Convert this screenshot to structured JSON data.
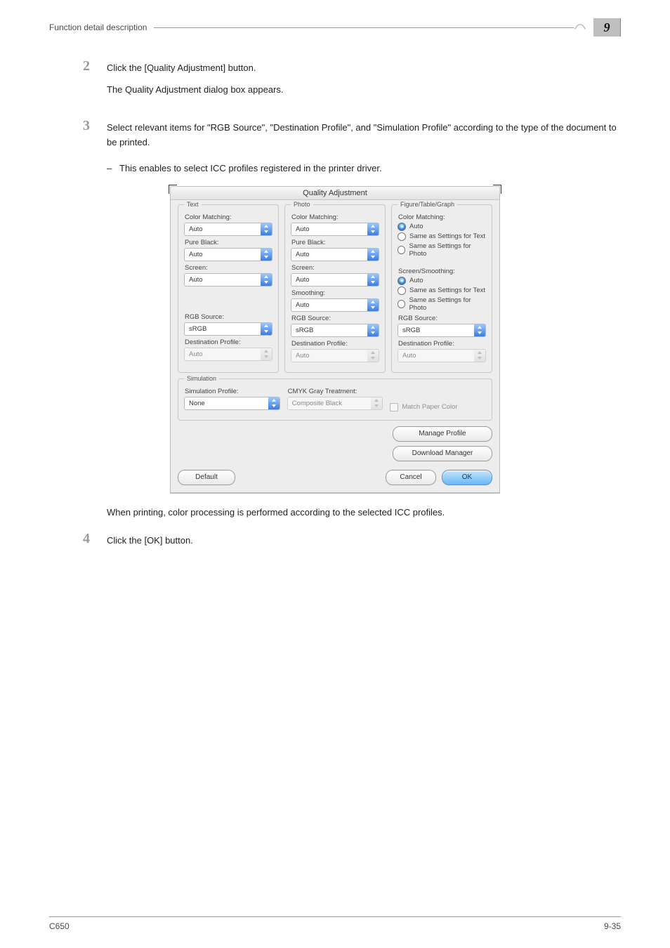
{
  "header": {
    "section_title": "Function detail description",
    "chapter_number": "9"
  },
  "steps": {
    "s2": {
      "num": "2",
      "p1": "Click the [Quality Adjustment] button.",
      "p2": "The Quality Adjustment dialog box appears."
    },
    "s3": {
      "num": "3",
      "p1": "Select relevant items for \"RGB Source\", \"Destination Profile\", and \"Simulation Profile\" according to the type of the document to be printed.",
      "bullet": "This enables to select ICC profiles registered in the printer driver."
    },
    "s3_note": "When printing, color processing is performed according to the selected ICC profiles.",
    "s4": {
      "num": "4",
      "p1": "Click the [OK] button."
    }
  },
  "dialog": {
    "title": "Quality Adjustment",
    "text_group": "Text",
    "photo_group": "Photo",
    "ftg_group": "Figure/Table/Graph",
    "sim_group": "Simulation",
    "labels": {
      "color_matching": "Color Matching:",
      "pure_black": "Pure Black:",
      "screen": "Screen:",
      "smoothing": "Smoothing:",
      "screen_smoothing": "Screen/Smoothing:",
      "rgb_source": "RGB Source:",
      "dest_profile": "Destination Profile:",
      "sim_profile": "Simulation Profile:",
      "cmyk_gray": "CMYK Gray Treatment:"
    },
    "values": {
      "auto": "Auto",
      "srgb": "sRGB",
      "none": "None",
      "composite_black": "Composite Black"
    },
    "radios": {
      "auto": "Auto",
      "same_text": "Same as Settings for Text",
      "same_photo": "Same as Settings for Photo"
    },
    "checks": {
      "match_paper": "Match Paper Color"
    },
    "buttons": {
      "manage_profile": "Manage Profile",
      "download_manager": "Download Manager",
      "default": "Default",
      "cancel": "Cancel",
      "ok": "OK"
    }
  },
  "footer": {
    "model": "C650",
    "page": "9-35"
  }
}
